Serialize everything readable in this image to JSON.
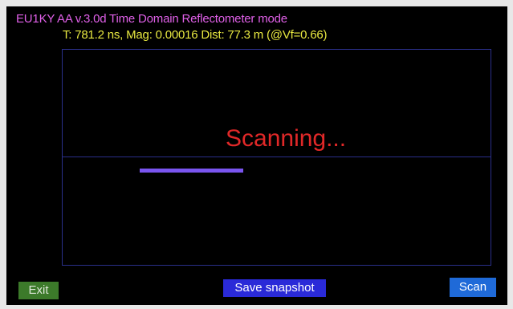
{
  "header": {
    "title": "EU1KY AA v.3.0d Time Domain Reflectometer mode",
    "status": "T: 781.2 ns, Mag: 0.00016 Dist: 77.3 m (@Vf=0.66)"
  },
  "plot": {
    "message": "Scanning...",
    "progress_fraction": 0.43
  },
  "buttons": {
    "exit": "Exit",
    "save_snapshot": "Save snapshot",
    "scan": "Scan"
  },
  "colors": {
    "title": "#e060e8",
    "status": "#e8e840",
    "scanning": "#e02828",
    "progress": "#7a55f0",
    "grid": "#2a2f8a",
    "exit_button": "#3c7a2a",
    "save_button": "#2a2ad8",
    "scan_button": "#1f6ad8"
  }
}
